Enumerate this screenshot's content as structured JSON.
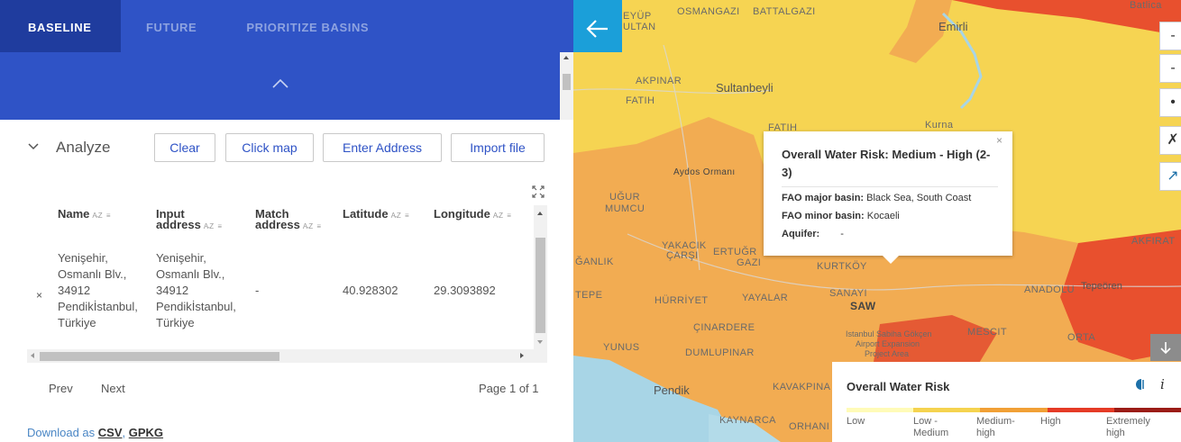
{
  "tabs": [
    {
      "label": "BASELINE"
    },
    {
      "label": "FUTURE"
    },
    {
      "label": "PRIORITIZE BASINS"
    }
  ],
  "analyze": {
    "title": "Analyze",
    "buttons": {
      "clear": "Clear",
      "click_map": "Click map",
      "enter_address": "Enter Address",
      "import_file": "Import file"
    }
  },
  "table": {
    "columns": [
      {
        "label_line1": "",
        "label_line2": "Name"
      },
      {
        "label_line1": "Input",
        "label_line2": "address"
      },
      {
        "label_line1": "Match",
        "label_line2": "address"
      },
      {
        "label_line1": "",
        "label_line2": "Latitude"
      },
      {
        "label_line1": "",
        "label_line2": "Longitude"
      }
    ],
    "sort_glyph": "A̵Z ≡",
    "rows": [
      {
        "remove": "×",
        "name": [
          "Yenişehir,",
          "Osmanlı Blv.,",
          "34912",
          "Pendikİstanbul,",
          "Türkiye"
        ],
        "input_address": [
          "Yenişehir,",
          "Osmanlı Blv.,",
          "34912",
          "Pendikİstanbul,",
          "Türkiye"
        ],
        "match_address": "-",
        "latitude": "40.928302",
        "longitude": "29.3093892"
      }
    ]
  },
  "pager": {
    "prev": "Prev",
    "next": "Next",
    "page": "Page 1 of 1"
  },
  "download": {
    "prefix": "Download as",
    "csv": "CSV",
    "gpkg": "GPKG"
  },
  "map": {
    "labels": {
      "eyup": "EYÜP",
      "ultan": "ULTAN",
      "osmangazi": "OSMANGAZI",
      "battalgazi": "BATTALGAZI",
      "emirli": "Emirli",
      "akpinar": "AKPINAR",
      "fatih1": "FATIH",
      "sultanbeyli": "Sultanbeyli",
      "fatih2": "FATIH",
      "kurna": "Kurna",
      "aydos": "Aydos Ormanı",
      "ugur": "UĞUR",
      "mumcu": "MUMCU",
      "yakacik": "YAKACIK",
      "carsi": "ÇARŞI",
      "ertugrul": "ERTUĞR",
      "gazi": "GAZI",
      "kurtkoy": "KURTKÖY",
      "akfirat": "AKFIRAT",
      "ganlik": "ĞANLIK",
      "anadolu": "ANADOLU",
      "tepeoren": "Tepeören",
      "tepe": "TEPE",
      "hurriyet": "HÜRRİYET",
      "yayalar": "YAYALAR",
      "sanayi": "SANAYI",
      "saw": "SAW",
      "cinardere": "ÇINARDERE",
      "sabiha1": "Istanbul Sabiha Gökçen",
      "sabiha2": "Airport Expansion",
      "sabiha3": "Project Area",
      "mescit": "MESCIT",
      "orta": "ORTA",
      "yunus": "YUNUS",
      "dumlupinar": "DUMLUPINAR",
      "pendik": "Pendik",
      "kavakpina": "KAVAKPINA",
      "kaynarca": "KAYNARCA",
      "orhani": "ORHANI",
      "batlica": "Batlica"
    },
    "zoom_controls": [
      "-",
      "-",
      "•",
      "✗",
      "↗"
    ],
    "popup": {
      "close": "×",
      "title": "Overall Water Risk: Medium - High (2-3)",
      "rows": [
        {
          "label": "FAO major basin:",
          "value": "Black Sea, South Coast"
        },
        {
          "label": "FAO minor basin:",
          "value": "Kocaeli"
        },
        {
          "label": "Aquifer:",
          "value": "-"
        }
      ]
    },
    "legend": {
      "title": "Overall Water Risk",
      "info": "i",
      "categories": [
        {
          "line1": "Low",
          "line2": "",
          "color": "#fffbb8"
        },
        {
          "line1": "Low -",
          "line2": "Medium",
          "color": "#f5d34f"
        },
        {
          "line1": "Medium-",
          "line2": "high",
          "color": "#f1a036"
        },
        {
          "line1": "High",
          "line2": "",
          "color": "#e53b26"
        },
        {
          "line1": "Extremely",
          "line2": "high",
          "color": "#9b1c17"
        }
      ]
    }
  }
}
